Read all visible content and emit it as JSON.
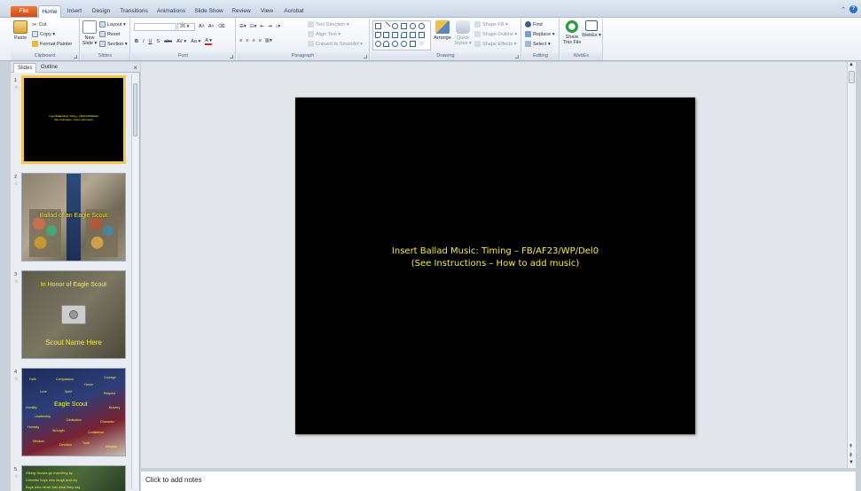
{
  "tabs": [
    "File",
    "Home",
    "Insert",
    "Design",
    "Transitions",
    "Animations",
    "Slide Show",
    "Review",
    "View",
    "Acrobat"
  ],
  "ribbon": {
    "clipboard": {
      "label": "Clipboard",
      "paste": "Paste",
      "cut": "Cut",
      "copy": "Copy ▾",
      "format_painter": "Format Painter"
    },
    "slides": {
      "label": "Slides",
      "new_slide": "New Slide ▾",
      "layout": "Layout ▾",
      "reset": "Reset",
      "section": "Section ▾"
    },
    "font": {
      "label": "Font",
      "font_size": "26",
      "bold": "B",
      "italic": "I",
      "underline": "U",
      "strike": "S",
      "shadow": "abc",
      "spacing": "AV ▾",
      "case": "Aa ▾",
      "color": "A ▾",
      "grow": "A˄",
      "shrink": "A˅",
      "clear": "⌫"
    },
    "paragraph": {
      "label": "Paragraph",
      "text_direction": "Text Direction ▾",
      "align_text": "Align Text ▾",
      "smartart": "Convert to SmartArt ▾"
    },
    "drawing": {
      "label": "Drawing",
      "arrange": "Arrange",
      "quick_styles": "Quick Styles ▾",
      "shape_fill": "Shape Fill ▾",
      "shape_outline": "Shape Outline ▾",
      "shape_effects": "Shape Effects ▾"
    },
    "editing": {
      "label": "Editing",
      "find": "Find",
      "replace": "Replace ▾",
      "select": "Select ▾"
    },
    "webex": {
      "label": "WebEx",
      "share": "Share This File",
      "webex": "WebEx ▾"
    }
  },
  "left_panel": {
    "tab_slides": "Slides",
    "tab_outline": "Outline",
    "close": "×",
    "thumbnails": [
      {
        "num": "1",
        "text": "Insert Ballad Music: Timing – FB/AF23/WP/Del0\n(See Instructions – How to add music)"
      },
      {
        "num": "2",
        "text": "Ballad of an Eagle Scout"
      },
      {
        "num": "3",
        "text_top": "In Honor of Eagle Scout",
        "text_bottom": "Scout Name Here"
      },
      {
        "num": "4",
        "words": [
          "Faith",
          "Compassion",
          "Courage",
          "Honor",
          "Love",
          "Spirit",
          "Respect",
          "Eagle Scout",
          "Humility",
          "Leadership",
          "Bravery",
          "Dedication",
          "Character",
          "Honesty",
          "Strength",
          "Confidence",
          "Wisdom",
          "Devotion",
          "Truth",
          "Integrity"
        ]
      },
      {
        "num": "5",
        "lines": [
          "Hiking Scouts go marching by",
          "Cheerful boys who laugh and cry",
          "Boys who never lost what they say"
        ]
      }
    ]
  },
  "slide": {
    "line1": "Insert Ballad Music:  Timing – FB/AF23/WP/Del0",
    "line2": "(See Instructions – How to add music)"
  },
  "notes": {
    "placeholder": "Click to add notes"
  },
  "colors": {
    "slide_text": "#f4ee3a",
    "file_tab": "#e0612a",
    "selected_border": "#f5c74a"
  }
}
